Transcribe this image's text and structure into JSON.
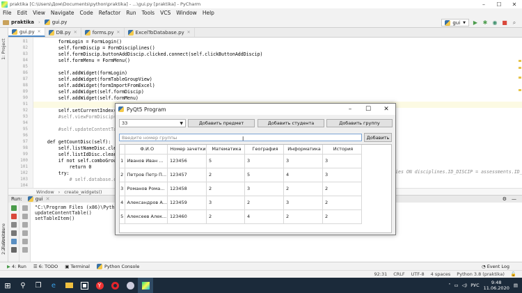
{
  "ide": {
    "title": "praktika [C:\\Users\\Дом\\Documents\\python\\praktika] - ...\\gui.py [praktika] - PyCharm",
    "menu": [
      "File",
      "Edit",
      "View",
      "Navigate",
      "Code",
      "Refactor",
      "Run",
      "Tools",
      "VCS",
      "Window",
      "Help"
    ],
    "breadcrumb": [
      "praktika",
      "gui.py"
    ],
    "run_config": "gui",
    "tabs": [
      {
        "label": "gui.py",
        "active": true
      },
      {
        "label": "DB.py",
        "active": false
      },
      {
        "label": "forms.py",
        "active": false
      },
      {
        "label": "ExcelToDatabase.py",
        "active": false
      }
    ],
    "left_tools": [
      "1: Project"
    ],
    "left_tools_bottom": [
      "Z: Structure",
      "2: Favorites"
    ],
    "code_lines": [
      {
        "n": "81",
        "text": "        formLogin = FormLogin()"
      },
      {
        "n": "82",
        "text": "        self.formDiscip = FormDisciplines()"
      },
      {
        "n": "83",
        "text": "        self.formDiscip.buttonAddDiscip.clicked.connect(self.clickButtonAddDiscip)"
      },
      {
        "n": "84",
        "text": "        self.formMenu = FormMenu()"
      },
      {
        "n": "85",
        "text": ""
      },
      {
        "n": "86",
        "text": "        self.addWidget(formLogin)"
      },
      {
        "n": "87",
        "text": "        self.addWidget(formTableGroupView)"
      },
      {
        "n": "88",
        "text": "        self.addWidget(formImportFromExcel)"
      },
      {
        "n": "89",
        "text": "        self.addWidget(self.formDiscip)"
      },
      {
        "n": "90",
        "text": "        self.addWidget(self.formMenu)"
      },
      {
        "n": "91",
        "text": ""
      },
      {
        "n": "92",
        "text": "        self.setCurrentIndex(1)"
      },
      {
        "n": "93",
        "text": "        #self.viewFormDiscip()"
      },
      {
        "n": "94",
        "text": ""
      },
      {
        "n": "95",
        "text": "        #self.updateContentTable"
      },
      {
        "n": "96",
        "text": ""
      },
      {
        "n": "97",
        "text": "    def getCountDisc(self):"
      },
      {
        "n": "98",
        "text": "        self.listNameDisc.clear"
      },
      {
        "n": "99",
        "text": "        self.listIdDisc.clear()"
      },
      {
        "n": "100",
        "text": "        if not self.comboGroup"
      },
      {
        "n": "101",
        "text": "            return 0"
      },
      {
        "n": "102",
        "text": "        try:"
      },
      {
        "n": "103",
        "text": "            # self.database.cu"
      },
      {
        "n": "104",
        "text": ""
      }
    ],
    "code_overflow_text": "ies ON disciplines.ID_DISCIP = assessments.ID_",
    "editor_breadcrumb": [
      "Window",
      "create_widgets()"
    ],
    "run_tab": "gui",
    "run_label": "Run:",
    "console_lines": [
      "\"C:\\Program Files (x86)\\Python",
      "updateContentTable()",
      "setTableItem()"
    ],
    "bottom_tools": [
      "4: Run",
      "6: TODO",
      "Terminal",
      "Python Console"
    ],
    "event_log": "Event Log",
    "status": [
      "92:31",
      "CRLF",
      "UTF-8",
      "4 spaces",
      "Python 3.8 (praktika)"
    ],
    "taskbar_time": "9:48",
    "taskbar_date": "11.06.2020",
    "taskbar_lang": "РУС"
  },
  "app": {
    "title": "PyQt5 Program",
    "combo_value": "33",
    "buttons": {
      "add_subject": "Добавить предмет",
      "add_student": "Добавить студента",
      "add_group": "Добавить группу",
      "add": "Добавить"
    },
    "group_placeholder": "Введите номер группы",
    "table": {
      "headers": [
        "Ф.И.О",
        "Номер зачетки",
        "Математика",
        "География",
        "Информатика",
        "История"
      ],
      "rows": [
        {
          "num": "1",
          "cells": [
            "Иванов Иван ...",
            "123456",
            "5",
            "3",
            "3",
            "3"
          ]
        },
        {
          "num": "2",
          "cells": [
            "Петров Петр П...",
            "123457",
            "2",
            "5",
            "4",
            "3"
          ]
        },
        {
          "num": "3",
          "cells": [
            "Романов Рома...",
            "123458",
            "2",
            "3",
            "2",
            "2"
          ]
        },
        {
          "num": "4",
          "cells": [
            "Александров А...",
            "123459",
            "3",
            "2",
            "3",
            "2"
          ]
        },
        {
          "num": "5",
          "cells": [
            "Алексеев Алек...",
            "123460",
            "2",
            "4",
            "2",
            "2"
          ]
        }
      ]
    }
  }
}
